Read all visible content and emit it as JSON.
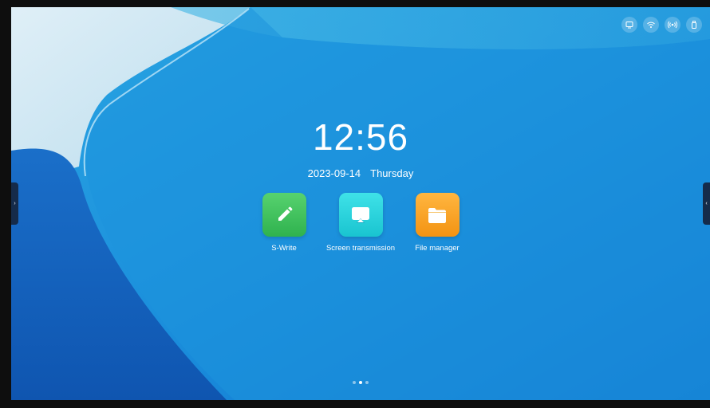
{
  "status_bar": {
    "icons": [
      "display-icon",
      "wifi-icon",
      "hotspot-icon",
      "usb-icon"
    ]
  },
  "clock": {
    "time": "12:56",
    "date": "2023-09-14",
    "weekday": "Thursday"
  },
  "apps": [
    {
      "label": "S-Write",
      "icon": "pencil-icon",
      "color": "#3cc35c"
    },
    {
      "label": "Screen transmission",
      "icon": "screencast-icon",
      "color": "#23cdd8"
    },
    {
      "label": "File manager",
      "icon": "folder-icon",
      "color": "#f7a12a"
    }
  ],
  "pager": {
    "count": 3,
    "active": 2
  },
  "side_tabs": {
    "left_glyph": "›",
    "right_glyph": "‹"
  }
}
